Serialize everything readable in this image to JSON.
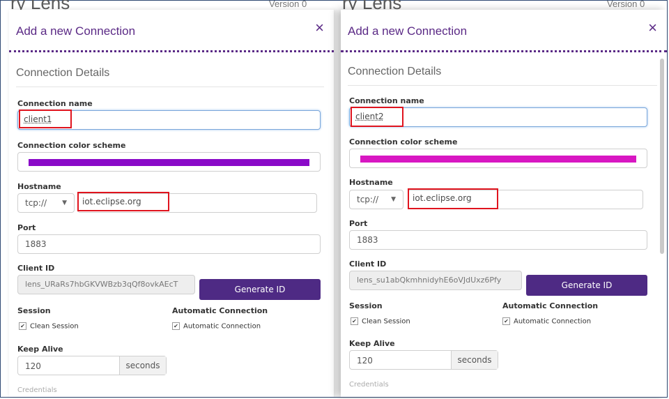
{
  "background": {
    "title_fragment": "ry Lens",
    "version_fragment": "Version 0"
  },
  "panels": [
    {
      "id": "left",
      "title": "Add a new Connection",
      "close": "×",
      "section": "Connection Details",
      "connection_name_label": "Connection name",
      "connection_name": "client1",
      "color_label": "Connection color scheme",
      "color": "#8a0ac8",
      "hostname_label": "Hostname",
      "protocol": "tcp://",
      "host": "iot.eclipse.org",
      "port_label": "Port",
      "port": "1883",
      "client_id_label": "Client ID",
      "client_id": "lens_URaRs7hbGKVWBzb3qQf8ovkAEcT",
      "generate": "Generate ID",
      "session_label": "Session",
      "clean_session": "Clean Session",
      "auto_label": "Automatic Connection",
      "auto_connection": "Automatic Connection",
      "keepalive_label": "Keep Alive",
      "keepalive": "120",
      "keepalive_unit": "seconds",
      "faded": "Credentials"
    },
    {
      "id": "right",
      "title": "Add a new Connection",
      "close": "×",
      "section": "Connection Details",
      "connection_name_label": "Connection name",
      "connection_name": "client2",
      "color_label": "Connection color scheme",
      "color": "#d817c2",
      "hostname_label": "Hostname",
      "protocol": "tcp://",
      "host": "iot.eclipse.org",
      "port_label": "Port",
      "port": "1883",
      "client_id_label": "Client ID",
      "client_id": "lens_su1abQkmhnidyhE6oVJdUxz6Pfy",
      "generate": "Generate ID",
      "session_label": "Session",
      "clean_session": "Clean Session",
      "auto_label": "Automatic Connection",
      "auto_connection": "Automatic Connection",
      "keepalive_label": "Keep Alive",
      "keepalive": "120",
      "keepalive_unit": "seconds",
      "faded": "Credentials"
    }
  ]
}
